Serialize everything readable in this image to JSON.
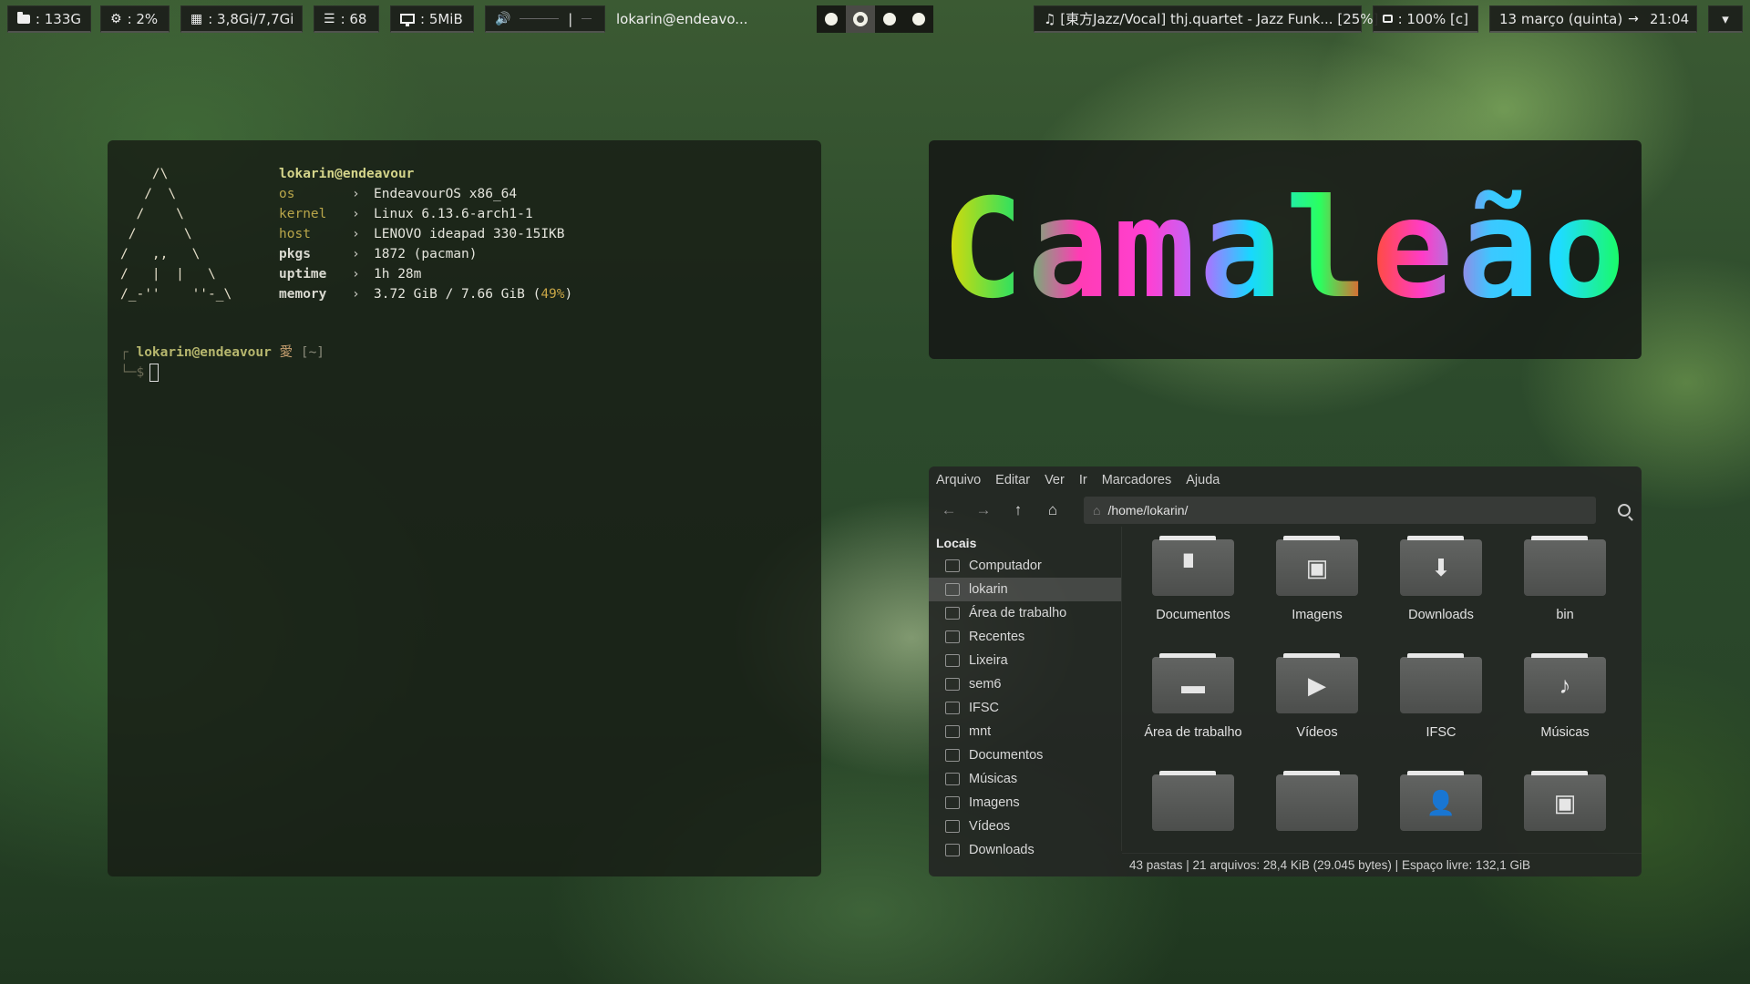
{
  "topbar": {
    "disk": ": 133G",
    "cpu": ":  2%",
    "ram": ": 3,8Gi/7,7Gi",
    "tasks": ": 68",
    "net": ": 5MiB",
    "volume_sep": "|",
    "window_title": "lokarin@endeavo...",
    "workspaces": [
      "1",
      "2",
      "3",
      "4"
    ],
    "active_workspace": 2,
    "music": "♫ [東方Jazz/Vocal] thj.quartet - Jazz Funk... [25%]",
    "battery": ": 100% [c]",
    "date": "13 março (quinta)",
    "time": "21:04",
    "menu_chevron": "▾"
  },
  "terminal": {
    "logo": "    /\\\n   /  \\\n  /    \\\n /      \\\n/   ,,   \\\n/   |  |   \\\n/_-''    ''-_\\",
    "user_host": "lokarin@endeavour",
    "info": [
      {
        "key": "os",
        "value": "EndeavourOS x86_64"
      },
      {
        "key": "kernel",
        "value": "Linux 6.13.6-arch1-1"
      },
      {
        "key": "host",
        "value": "LENOVO ideapad 330-15IKB"
      },
      {
        "key": "pkgs",
        "value": "1872 (pacman)"
      },
      {
        "key": "uptime",
        "value": "1h 28m"
      },
      {
        "key": "memory",
        "value": "3.72 GiB / 7.66 GiB (",
        "pct": "49%",
        "tail": ")"
      }
    ],
    "arrow": "›",
    "prompt": {
      "bracket_top": "┌",
      "user": "lokarin@endeavour",
      "ai": "愛",
      "dir": "[~]",
      "bracket_bottom": "└─",
      "dollar": "$"
    }
  },
  "banner": {
    "text": "Camaleão"
  },
  "file_manager": {
    "menu": [
      "Arquivo",
      "Editar",
      "Ver",
      "Ir",
      "Marcadores",
      "Ajuda"
    ],
    "path": "/home/lokarin/",
    "sidebar_heading": "Locais",
    "sidebar": [
      {
        "label": "Computador",
        "icon": "computer-icon"
      },
      {
        "label": "lokarin",
        "icon": "home-icon",
        "selected": true
      },
      {
        "label": "Área de trabalho",
        "icon": "desktop-icon"
      },
      {
        "label": "Recentes",
        "icon": "clock-icon"
      },
      {
        "label": "Lixeira",
        "icon": "trash-icon"
      },
      {
        "label": "sem6",
        "icon": "folder-icon"
      },
      {
        "label": "IFSC",
        "icon": "folder-icon"
      },
      {
        "label": "mnt",
        "icon": "folder-icon"
      },
      {
        "label": "Documentos",
        "icon": "document-icon"
      },
      {
        "label": "Músicas",
        "icon": "music-icon"
      },
      {
        "label": "Imagens",
        "icon": "image-icon"
      },
      {
        "label": "Vídeos",
        "icon": "video-icon"
      },
      {
        "label": "Downloads",
        "icon": "download-icon"
      }
    ],
    "items": [
      {
        "label": "Documentos",
        "glyph": "▘",
        "icon": "documents-folder-icon"
      },
      {
        "label": "Imagens",
        "glyph": "▣",
        "icon": "images-folder-icon"
      },
      {
        "label": "Downloads",
        "glyph": "⬇",
        "icon": "downloads-folder-icon"
      },
      {
        "label": "bin",
        "glyph": "",
        "icon": "folder-icon"
      },
      {
        "label": "Área de trabalho",
        "glyph": "▬",
        "icon": "desktop-folder-icon"
      },
      {
        "label": "Vídeos",
        "glyph": "▶",
        "icon": "videos-folder-icon"
      },
      {
        "label": "IFSC",
        "glyph": "",
        "icon": "folder-icon"
      },
      {
        "label": "Músicas",
        "glyph": "♪",
        "icon": "music-folder-icon"
      },
      {
        "label": "",
        "glyph": "",
        "icon": "folder-icon"
      },
      {
        "label": "",
        "glyph": "",
        "icon": "folder-icon"
      },
      {
        "label": "",
        "glyph": "👤",
        "icon": "user-folder-icon"
      },
      {
        "label": "",
        "glyph": "▣",
        "icon": "screenshot-folder-icon"
      }
    ],
    "status": "43 pastas  |  21 arquivos: 28,4 KiB (29.045 bytes)  |  Espaço livre: 132,1 GiB"
  }
}
